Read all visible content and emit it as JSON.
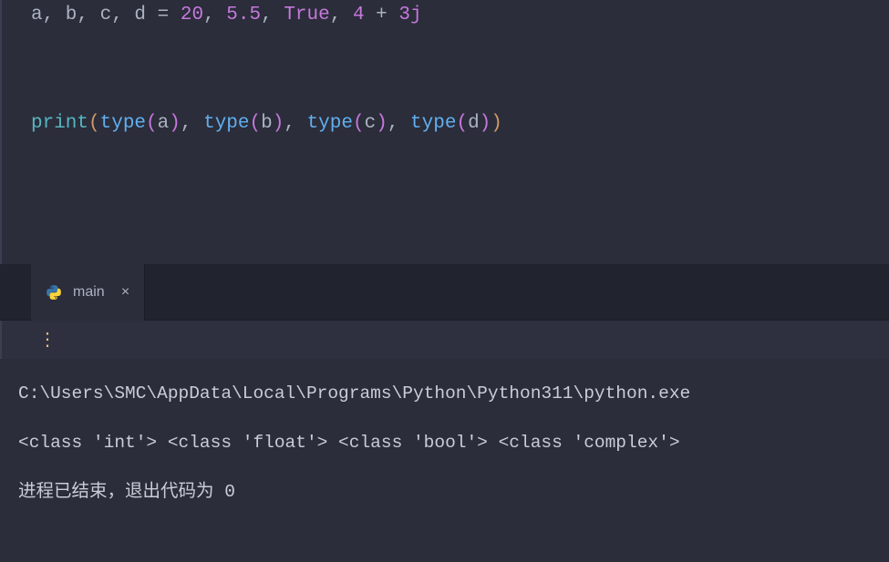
{
  "editor": {
    "code": {
      "line1": {
        "vars": "a, b, c, d",
        "assign": " = ",
        "num1": "20",
        "comma1": ", ",
        "num2": "5.5",
        "comma2": ", ",
        "bool": "True",
        "comma3": ", ",
        "num3": "4",
        "plus": " + ",
        "num4": "3j"
      },
      "line2": {
        "print": "print",
        "open": "(",
        "type1": "type",
        "p1o": "(",
        "a": "a",
        "p1c": ")",
        "c1": ", ",
        "type2": "type",
        "p2o": "(",
        "b": "b",
        "p2c": ")",
        "c2": ", ",
        "type3": "type",
        "p3o": "(",
        "c": "c",
        "p3c": ")",
        "c3": ", ",
        "type4": "type",
        "p4o": "(",
        "d": "d",
        "p4c": ")",
        "close": ")"
      }
    }
  },
  "tab": {
    "label": "main"
  },
  "console": {
    "line1": "C:\\Users\\SMC\\AppData\\Local\\Programs\\Python\\Python311\\python.exe",
    "line2": "<class 'int'> <class 'float'> <class 'bool'> <class 'complex'>",
    "line3": "进程已结束，退出代码为 0"
  }
}
